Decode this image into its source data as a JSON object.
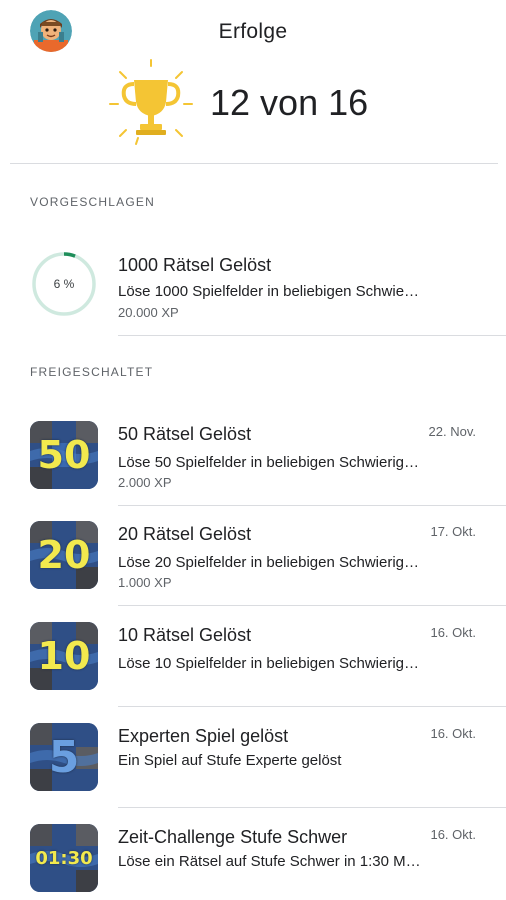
{
  "header": {
    "title": "Erfolge",
    "score_text": "12 von 16",
    "trophy_color": "#f4c534"
  },
  "sections": {
    "suggested_label": "VORGESCHLAGEN",
    "unlocked_label": "FREIGESCHALTET"
  },
  "suggested": {
    "progress_text": "6 %",
    "progress": 0.06,
    "title": "1000 Rätsel Gelöst",
    "description": "Löse 1000 Spielfelder in beliebigen Schwie…",
    "xp": "20.000 XP"
  },
  "achievements": [
    {
      "badge_text": "50",
      "title": "50 Rätsel Gelöst",
      "description": "Löse 50 Spielfelder in beliebigen Schwierig…",
      "xp": "2.000 XP",
      "date": "22. Nov."
    },
    {
      "badge_text": "20",
      "title": "20 Rätsel Gelöst",
      "description": "Löse 20 Spielfelder in beliebigen Schwierig…",
      "xp": "1.000 XP",
      "date": "17. Okt."
    },
    {
      "badge_text": "10",
      "title": "10 Rätsel Gelöst",
      "description": "Löse 10 Spielfelder in beliebigen Schwierig…",
      "xp": "",
      "date": "16. Okt."
    },
    {
      "badge_text": "5",
      "title": "Experten Spiel gelöst",
      "description": "Ein Spiel auf Stufe Experte gelöst",
      "xp": "",
      "date": "16. Okt."
    },
    {
      "badge_text": "01:30",
      "title": "Zeit-Challenge Stufe Schwer",
      "description": "Löse ein Rätsel auf Stufe Schwer in 1:30 M…",
      "xp": "",
      "date": "16. Okt."
    }
  ],
  "colors": {
    "progress_ring": "#1e8e5a",
    "progress_track": "#cfe9df",
    "badge_yellow": "#f2e94e",
    "badge_blue": "#6a9fe0"
  }
}
